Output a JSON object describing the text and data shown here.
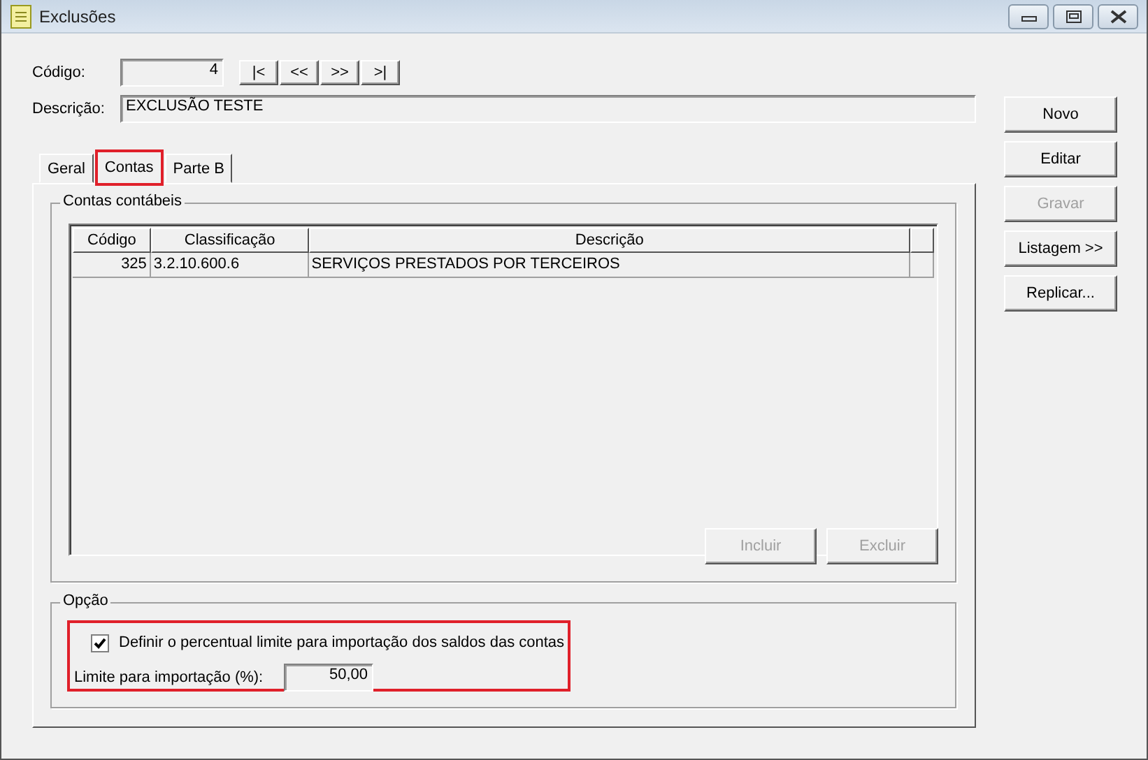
{
  "window": {
    "title": "Exclusões"
  },
  "codigo": {
    "label": "Código:",
    "value": "4"
  },
  "nav_buttons": [
    "|<",
    "<<",
    ">>",
    ">|"
  ],
  "descricao": {
    "label": "Descrição:",
    "value": "EXCLUSÃO TESTE"
  },
  "tabs": [
    {
      "label": "Geral",
      "selected": false,
      "highlighted": false
    },
    {
      "label": "Contas",
      "selected": true,
      "highlighted": true
    },
    {
      "label": "Parte B",
      "selected": false,
      "highlighted": false
    }
  ],
  "accounts_group": {
    "title": "Contas contábeis",
    "columns": [
      "Código",
      "Classificação",
      "Descrição"
    ],
    "rows": [
      {
        "codigo": "325",
        "classificacao": "3.2.10.600.6",
        "descricao": "SERVIÇOS PRESTADOS POR TERCEIROS"
      }
    ],
    "buttons": [
      {
        "label": "Incluir",
        "disabled": true
      },
      {
        "label": "Excluir",
        "disabled": true
      }
    ]
  },
  "option_group": {
    "title": "Opção",
    "highlighted": true,
    "checkbox": {
      "label": "Definir o percentual limite para importação dos saldos das contas",
      "checked": true
    },
    "limit": {
      "label": "Limite para importação (%):",
      "value": "50,00"
    }
  },
  "side_buttons": [
    {
      "label": "Novo",
      "disabled": false
    },
    {
      "label": "Editar",
      "disabled": false
    },
    {
      "label": "Gravar",
      "disabled": true
    },
    {
      "label": "Listagem >>",
      "disabled": false
    },
    {
      "label": "Replicar...",
      "disabled": false
    }
  ]
}
